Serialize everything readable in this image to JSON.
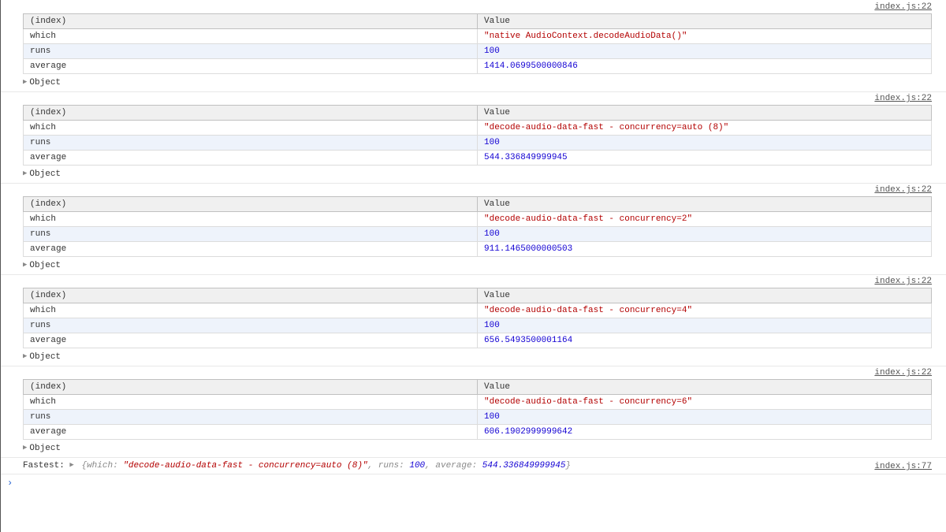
{
  "source_22": "index.js:22",
  "source_77": "index.js:77",
  "headers": {
    "index": "(index)",
    "value": "Value"
  },
  "rows": {
    "which": "which",
    "runs": "runs",
    "average": "average"
  },
  "object_label": "Object",
  "entries": [
    {
      "which": "\"native AudioContext.decodeAudioData()\"",
      "which_type": "str",
      "runs": "100",
      "average": "1414.0699500000846"
    },
    {
      "which": "\"decode-audio-data-fast - concurrency=auto (8)\"",
      "which_type": "str",
      "runs": "100",
      "average": "544.336849999945"
    },
    {
      "which": "\"decode-audio-data-fast - concurrency=2\"",
      "which_type": "str",
      "runs": "100",
      "average": "911.1465000000503"
    },
    {
      "which": "\"decode-audio-data-fast - concurrency=4\"",
      "which_type": "str",
      "runs": "100",
      "average": "656.5493500001164"
    },
    {
      "which": "\"decode-audio-data-fast - concurrency=6\"",
      "which_type": "str",
      "runs": "100",
      "average": "606.1902999999642"
    }
  ],
  "fastest": {
    "prefix": "Fastest: ",
    "which_key": "which",
    "which_val": "\"decode-audio-data-fast - concurrency=auto (8)\"",
    "runs_key": "runs",
    "runs_val": "100",
    "avg_key": "average",
    "avg_val": "544.336849999945"
  },
  "prompt_char": "›"
}
